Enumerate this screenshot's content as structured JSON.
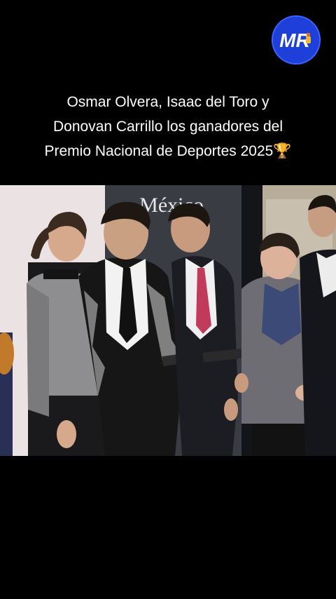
{
  "logo": {
    "text": "MR",
    "icon": "mr-logo-icon",
    "color": "#1e3fd8"
  },
  "caption": {
    "line1": "Osmar Olvera, Isaac del Toro y",
    "line2": "Donovan Carrillo los ganadores del",
    "line3": "Premio Nacional de Deportes 2025",
    "emoji": "🏆"
  },
  "photo": {
    "backdrop_text": "México",
    "description_icon": "award-ceremony-photo"
  }
}
